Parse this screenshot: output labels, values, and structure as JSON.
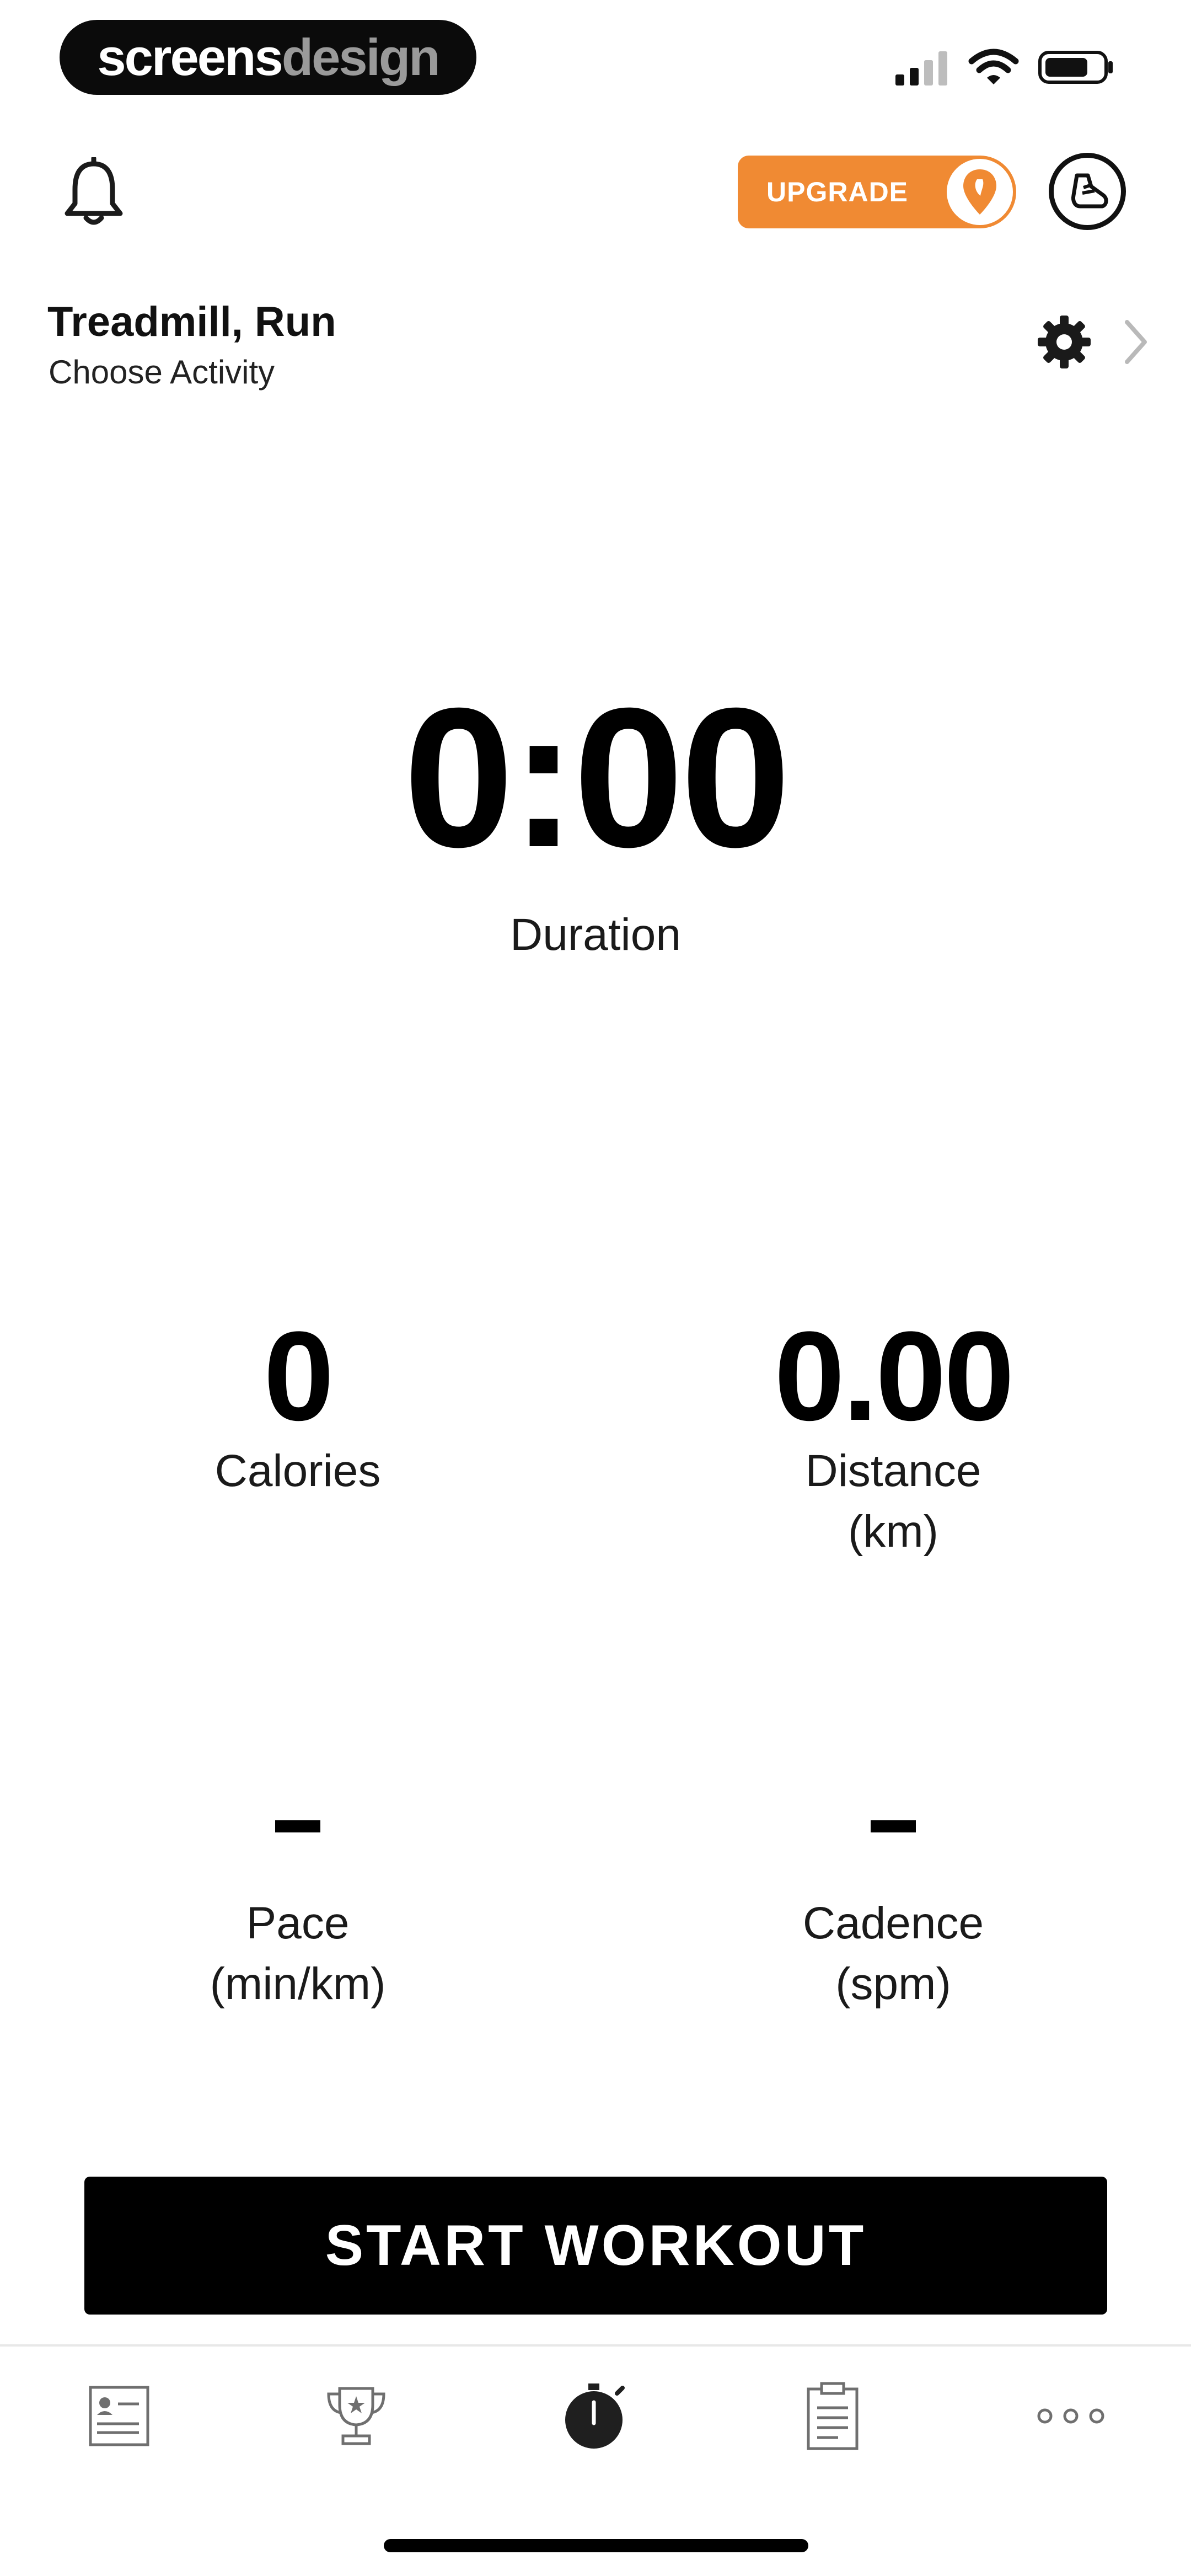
{
  "brand": {
    "part1": "screens",
    "part2": "design"
  },
  "status_bar": {
    "icons": [
      "cellular-signal-icon",
      "wifi-icon",
      "battery-icon"
    ]
  },
  "header": {
    "upgrade_label": "UPGRADE",
    "icons": [
      "bell-icon",
      "location-pin-icon",
      "shoe-icon"
    ],
    "accent_color": "#f08a33"
  },
  "activity": {
    "title": "Treadmill, Run",
    "subtitle": "Choose Activity"
  },
  "metrics": {
    "duration": {
      "value": "0:00",
      "label": "Duration"
    },
    "calories": {
      "value": "0",
      "label": "Calories"
    },
    "distance": {
      "value": "0.00",
      "label": "Distance",
      "unit": "(km)"
    },
    "pace": {
      "value": "-",
      "label": "Pace",
      "unit": "(min/km)"
    },
    "cadence": {
      "value": "-",
      "label": "Cadence",
      "unit": "(spm)"
    }
  },
  "start_button": {
    "label": "START WORKOUT"
  },
  "tab_bar": {
    "tabs": [
      {
        "icon": "profile-card-icon"
      },
      {
        "icon": "trophy-icon"
      },
      {
        "icon": "stopwatch-icon",
        "active": true
      },
      {
        "icon": "clipboard-icon"
      },
      {
        "icon": "more-dots-icon"
      }
    ]
  }
}
